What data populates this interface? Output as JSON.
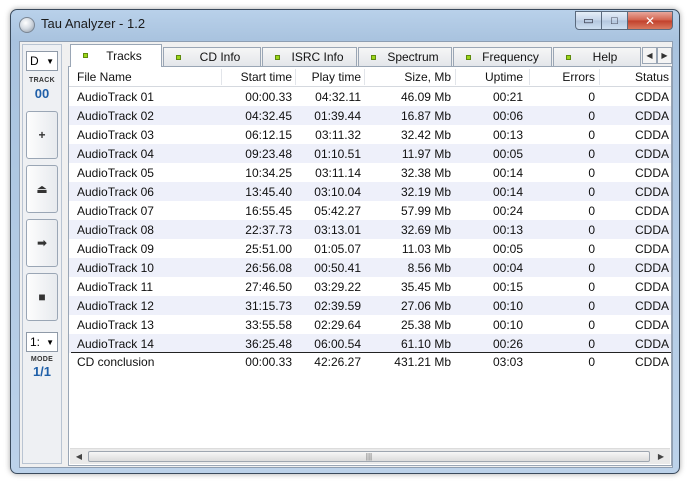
{
  "window": {
    "title": "Tau Analyzer - 1.2",
    "min_glyph": "▭",
    "max_glyph": "□",
    "close_glyph": "✕"
  },
  "left_panel": {
    "drive": "D",
    "dropdown_arrow": "▼",
    "track_label": "TRACK",
    "track_value": "00",
    "add_glyph": "+",
    "eject_glyph": "⏏",
    "next_glyph": "➡",
    "stop_glyph": "■",
    "mode_select": "1:",
    "mode_label": "MODE",
    "mode_value": "1/1"
  },
  "tabs": [
    {
      "label": "Tracks",
      "active": true
    },
    {
      "label": "CD Info",
      "active": false
    },
    {
      "label": "ISRC Info",
      "active": false
    },
    {
      "label": "Spectrum",
      "active": false
    },
    {
      "label": "Frequency",
      "active": false
    },
    {
      "label": "Help",
      "active": false
    }
  ],
  "tab_scroll": {
    "left": "◀",
    "right": "▶"
  },
  "columns": [
    "File Name",
    "Start time",
    "Play time",
    "Size, Mb",
    "Uptime",
    "Errors",
    "Status"
  ],
  "rows": [
    [
      "AudioTrack 01",
      "00:00.33",
      "04:32.11",
      "46.09 Mb",
      "00:21",
      "0",
      "CDDA"
    ],
    [
      "AudioTrack 02",
      "04:32.45",
      "01:39.44",
      "16.87 Mb",
      "00:06",
      "0",
      "CDDA"
    ],
    [
      "AudioTrack 03",
      "06:12.15",
      "03:11.32",
      "32.42 Mb",
      "00:13",
      "0",
      "CDDA"
    ],
    [
      "AudioTrack 04",
      "09:23.48",
      "01:10.51",
      "11.97 Mb",
      "00:05",
      "0",
      "CDDA"
    ],
    [
      "AudioTrack 05",
      "10:34.25",
      "03:11.14",
      "32.38 Mb",
      "00:14",
      "0",
      "CDDA"
    ],
    [
      "AudioTrack 06",
      "13:45.40",
      "03:10.04",
      "32.19 Mb",
      "00:14",
      "0",
      "CDDA"
    ],
    [
      "AudioTrack 07",
      "16:55.45",
      "05:42.27",
      "57.99 Mb",
      "00:24",
      "0",
      "CDDA"
    ],
    [
      "AudioTrack 08",
      "22:37.73",
      "03:13.01",
      "32.69 Mb",
      "00:13",
      "0",
      "CDDA"
    ],
    [
      "AudioTrack 09",
      "25:51.00",
      "01:05.07",
      "11.03 Mb",
      "00:05",
      "0",
      "CDDA"
    ],
    [
      "AudioTrack 10",
      "26:56.08",
      "00:50.41",
      "8.56 Mb",
      "00:04",
      "0",
      "CDDA"
    ],
    [
      "AudioTrack 11",
      "27:46.50",
      "03:29.22",
      "35.45 Mb",
      "00:15",
      "0",
      "CDDA"
    ],
    [
      "AudioTrack 12",
      "31:15.73",
      "02:39.59",
      "27.06 Mb",
      "00:10",
      "0",
      "CDDA"
    ],
    [
      "AudioTrack 13",
      "33:55.58",
      "02:29.64",
      "25.38 Mb",
      "00:10",
      "0",
      "CDDA"
    ],
    [
      "AudioTrack 14",
      "36:25.48",
      "06:00.54",
      "61.10 Mb",
      "00:26",
      "0",
      "CDDA"
    ]
  ],
  "summary": [
    "CD conclusion",
    "00:00.33",
    "42:26.27",
    "431.21 Mb",
    "03:03",
    "0",
    "CDDA"
  ],
  "hscroll": {
    "left": "◀",
    "right": "▶",
    "grip": "|||"
  },
  "colors": {
    "alt_row": "#eef0fa",
    "led": "#9cd61a",
    "mode_value": "#1f5fa8"
  }
}
